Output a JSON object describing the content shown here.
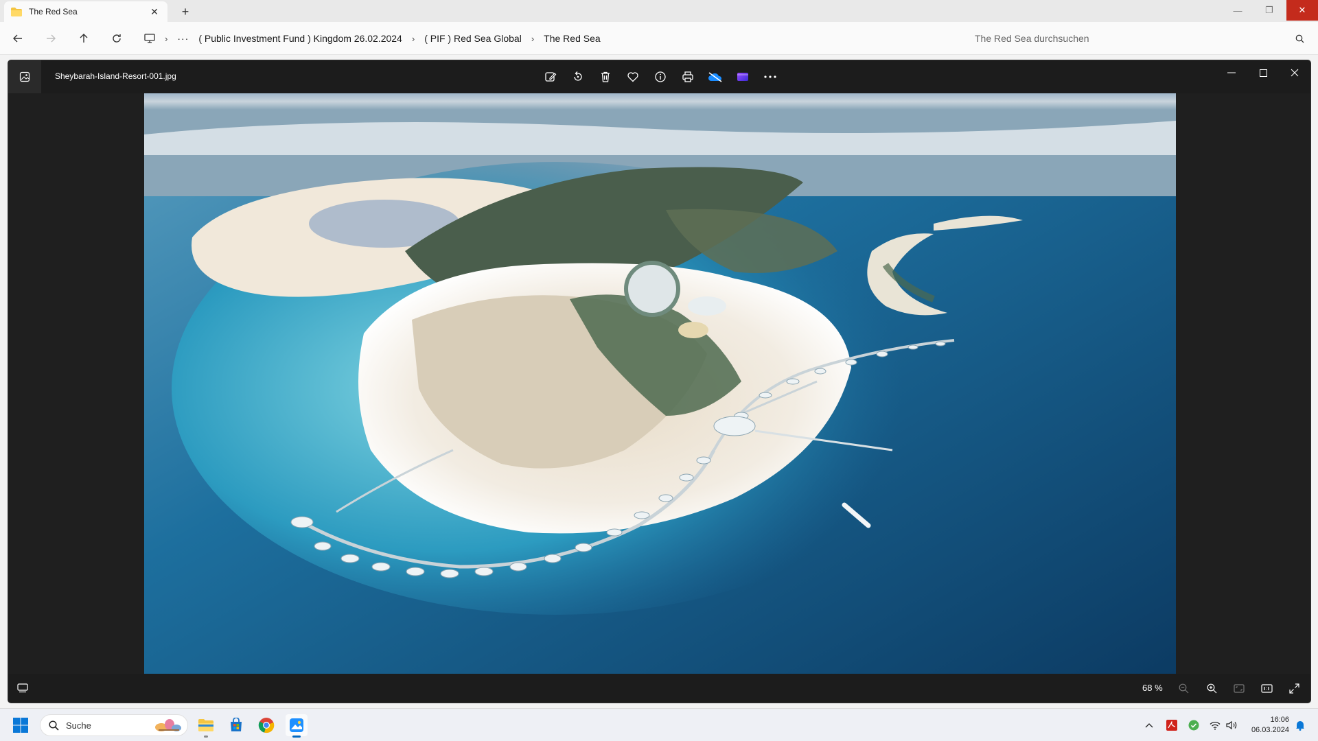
{
  "explorer": {
    "tab_title": "The Red Sea",
    "new_tab_symbol": "+",
    "breadcrumb": [
      "( Public Investment Fund ) Kingdom 26.02.2024",
      "( PIF ) Red Sea Global",
      "The Red Sea"
    ],
    "search_placeholder": "The Red Sea durchsuchen",
    "icons": {
      "back": "arrow-left-icon",
      "forward": "arrow-right-icon",
      "up": "arrow-up-icon",
      "refresh": "refresh-icon",
      "this_pc": "monitor-icon",
      "search": "search-icon"
    }
  },
  "photos": {
    "filename": "Sheybarah-Island-Resort-001.jpg",
    "toolbar_icons": [
      "edit-image-icon",
      "rotate-icon",
      "delete-icon",
      "favorite-icon",
      "info-icon",
      "print-icon",
      "onedrive-icon",
      "clipchamp-icon",
      "more-icon"
    ],
    "zoom_label": "68 %",
    "zoom_level": 68
  },
  "taskbar": {
    "search_placeholder": "Suche",
    "time": "16:06",
    "date": "06.03.2024",
    "apps": [
      "file-explorer-icon",
      "microsoft-store-icon",
      "chrome-icon",
      "photos-icon"
    ]
  },
  "colors": {
    "accent": "#0067c0",
    "close_red": "#c42b1c",
    "photos_bg": "#1f1f1f"
  }
}
